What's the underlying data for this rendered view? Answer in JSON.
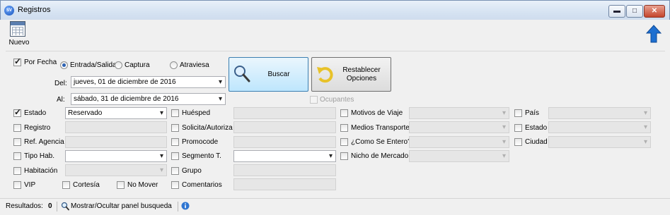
{
  "window": {
    "title": "Registros",
    "app_icon_text": "SV",
    "minimize_glyph": "▬",
    "maximize_glyph": "□",
    "close_glyph": "✕"
  },
  "toolbar": {
    "nuevo_label": "Nuevo"
  },
  "dates": {
    "por_fecha_label": "Por Fecha",
    "radio_entrada": "Entrada/Salida",
    "radio_captura": "Captura",
    "radio_atraviesa": "Atraviesa",
    "del_label": "Del:",
    "del_value": "jueves, 01 de diciembre de 2016",
    "al_label": "Al:",
    "al_value": "sábado, 31 de diciembre de 2016"
  },
  "actions": {
    "buscar_label": "Buscar",
    "restablecer_line1": "Restablecer",
    "restablecer_line2": "Opciones",
    "ocupantes_label": "Ocupantes"
  },
  "col1": {
    "estado_label": "Estado",
    "estado_value": "Reservado",
    "registro_label": "Registro",
    "ref_agencia_label": "Ref. Agencia",
    "tipo_hab_label": "Tipo Hab.",
    "habitacion_label": "Habitación",
    "vip_label": "VIP",
    "cortesia_label": "Cortesía",
    "no_mover_label": "No Mover"
  },
  "col2": {
    "huesped_label": "Huésped",
    "solicita_label": "Solicita/Autoriza",
    "promocode_label": "Promocode",
    "segmento_label": "Segmento T.",
    "grupo_label": "Grupo",
    "comentarios_label": "Comentarios"
  },
  "col3": {
    "motivos_label": "Motivos de Viaje",
    "medios_label": "Medios Transporte",
    "como_label": "¿Como Se Entero?",
    "nicho_label": "Nicho de Mercado"
  },
  "col4": {
    "pais_label": "País",
    "estado_label": "Estado",
    "ciudad_label": "Ciudad"
  },
  "status": {
    "resultados_label": "Resultados:",
    "resultados_value": "0",
    "toggle_label": "Mostrar/Ocultar panel busqueda"
  },
  "colors": {
    "accent": "#2d62b3",
    "up_arrow": "#1e6fd0"
  }
}
